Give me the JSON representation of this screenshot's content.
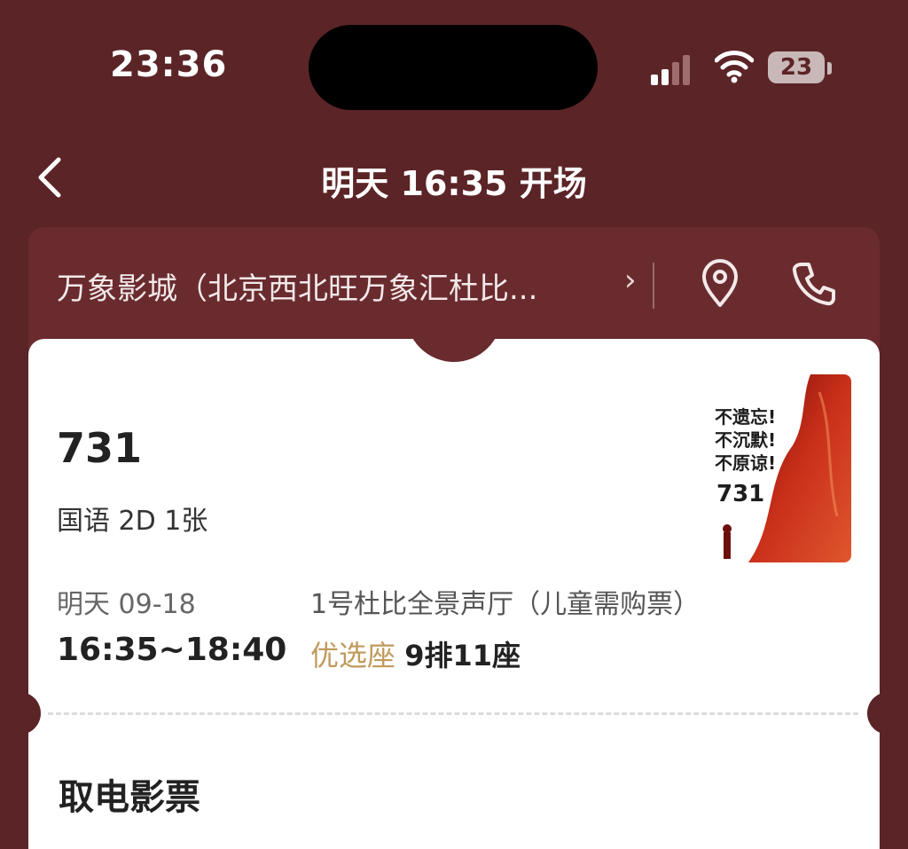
{
  "status_bar": {
    "time": "23:36",
    "battery": "23"
  },
  "nav": {
    "title": "明天 16:35 开场"
  },
  "cinema": {
    "name": "万象影城（北京西北旺万象汇杜比...",
    "arrow": "›"
  },
  "ticket": {
    "movie_title": "731",
    "meta": "国语 2D 1张",
    "date": "明天 09-18",
    "time_range": "16:35~18:40",
    "hall": "1号杜比全景声厅（儿童需购票）",
    "seat_tag": "优选座",
    "seat": "9排11座"
  },
  "poster": {
    "line1": "不遗忘!",
    "line2": "不沉默!",
    "line3": "不原谅!",
    "number": "731"
  },
  "pickup": {
    "title": "取电影票"
  },
  "colors": {
    "background": "#5b2427",
    "cinema_bar": "#6a2b2f",
    "seat_tag": "#c09a5b"
  }
}
